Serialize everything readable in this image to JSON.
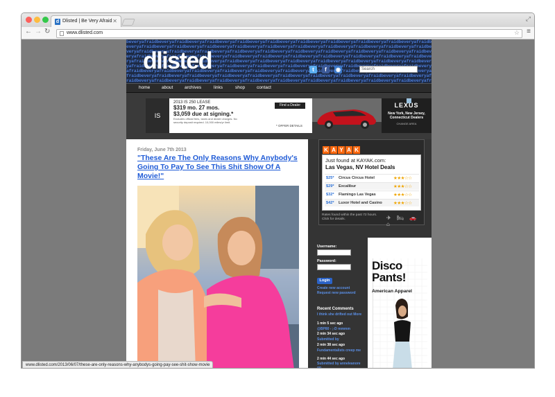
{
  "browser": {
    "tab_title": "Dlisted | Be Very Afraid",
    "tab_favicon": "d",
    "url": "www.dlisted.com",
    "status_url": "www.dlisted.com/2013/06/07/these-are-only-reasons-why-anybodys-going-pay-see-shit-show-movie"
  },
  "header": {
    "logo": "dlisted",
    "pattern_text": "beveryafraid",
    "search_placeholder": "Search",
    "social_icons": [
      "twitter-icon",
      "facebook-icon",
      "rss-icon"
    ]
  },
  "nav": {
    "items": [
      "home",
      "about",
      "archives",
      "links",
      "shop",
      "contact"
    ]
  },
  "lexus_ad": {
    "model": "IS",
    "headline": "2013 IS 250 LEASE",
    "monthly": "$319 mo. 27 mos.",
    "due": "$3,059 due at signing.*",
    "fine_print_1": "Excludes official fees, taxes and dealer charges. No",
    "fine_print_2": "security deposit required. 10,000 miles/yr limit.",
    "find_dealer": "Find a Dealer",
    "offer_details": "* OFFER DETAILS",
    "brand": "LEXUS",
    "dealers": "New York, New Jersey, Connecticut Dealers",
    "dealer_tag": "CHANGE AREA"
  },
  "post": {
    "date": "Friday, June 7th 2013",
    "title": "\"These Are The Only Reasons Why Anybody's Going To Pay To See This Shit Show Of A Movie!\""
  },
  "kayak": {
    "logo_letters": [
      "K",
      "A",
      "Y",
      "A",
      "K"
    ],
    "found_text": "Just found at KAYAK.com:",
    "city": "Las Vegas, NV Hotel Deals",
    "hotels": [
      {
        "price": "$25*",
        "name": "Circus Circus Hotel",
        "stars": "★★★☆☆"
      },
      {
        "price": "$29*",
        "name": "Excalibur",
        "stars": "★★★☆☆"
      },
      {
        "price": "$32*",
        "name": "Flamingo Las Vegas",
        "stars": "★★★☆☆"
      },
      {
        "price": "$42*",
        "name": "Luxor Hotel and Casino",
        "stars": "★★★☆☆"
      }
    ],
    "note": "Rates found within the past 72 hours. Click for details.",
    "icons": "✈ 🛏 🚗 ⌂"
  },
  "login": {
    "username_label": "Username:",
    "password_label": "Password:",
    "button": "Login",
    "create_link": "Create new account",
    "request_link": "Request new password"
  },
  "recent_comments": {
    "title": "Recent Comments",
    "items": [
      {
        "link": "I think she drifted out More",
        "time": "1 min 5 sec ago"
      },
      {
        "link": "@BP80 - ;-D mmmm",
        "time": "2 min 34 sec ago"
      },
      {
        "link": "Submitted by",
        "time": "2 min 38 sec ago"
      },
      {
        "link": "Fundamentalists creep me",
        "time": "2 min 44 sec ago"
      },
      {
        "link": "Submitted by anneleanore on",
        "time": ""
      }
    ]
  },
  "disco_ad": {
    "title_line1": "Disco",
    "title_line2": "Pants!",
    "brand": "American Apparel"
  }
}
